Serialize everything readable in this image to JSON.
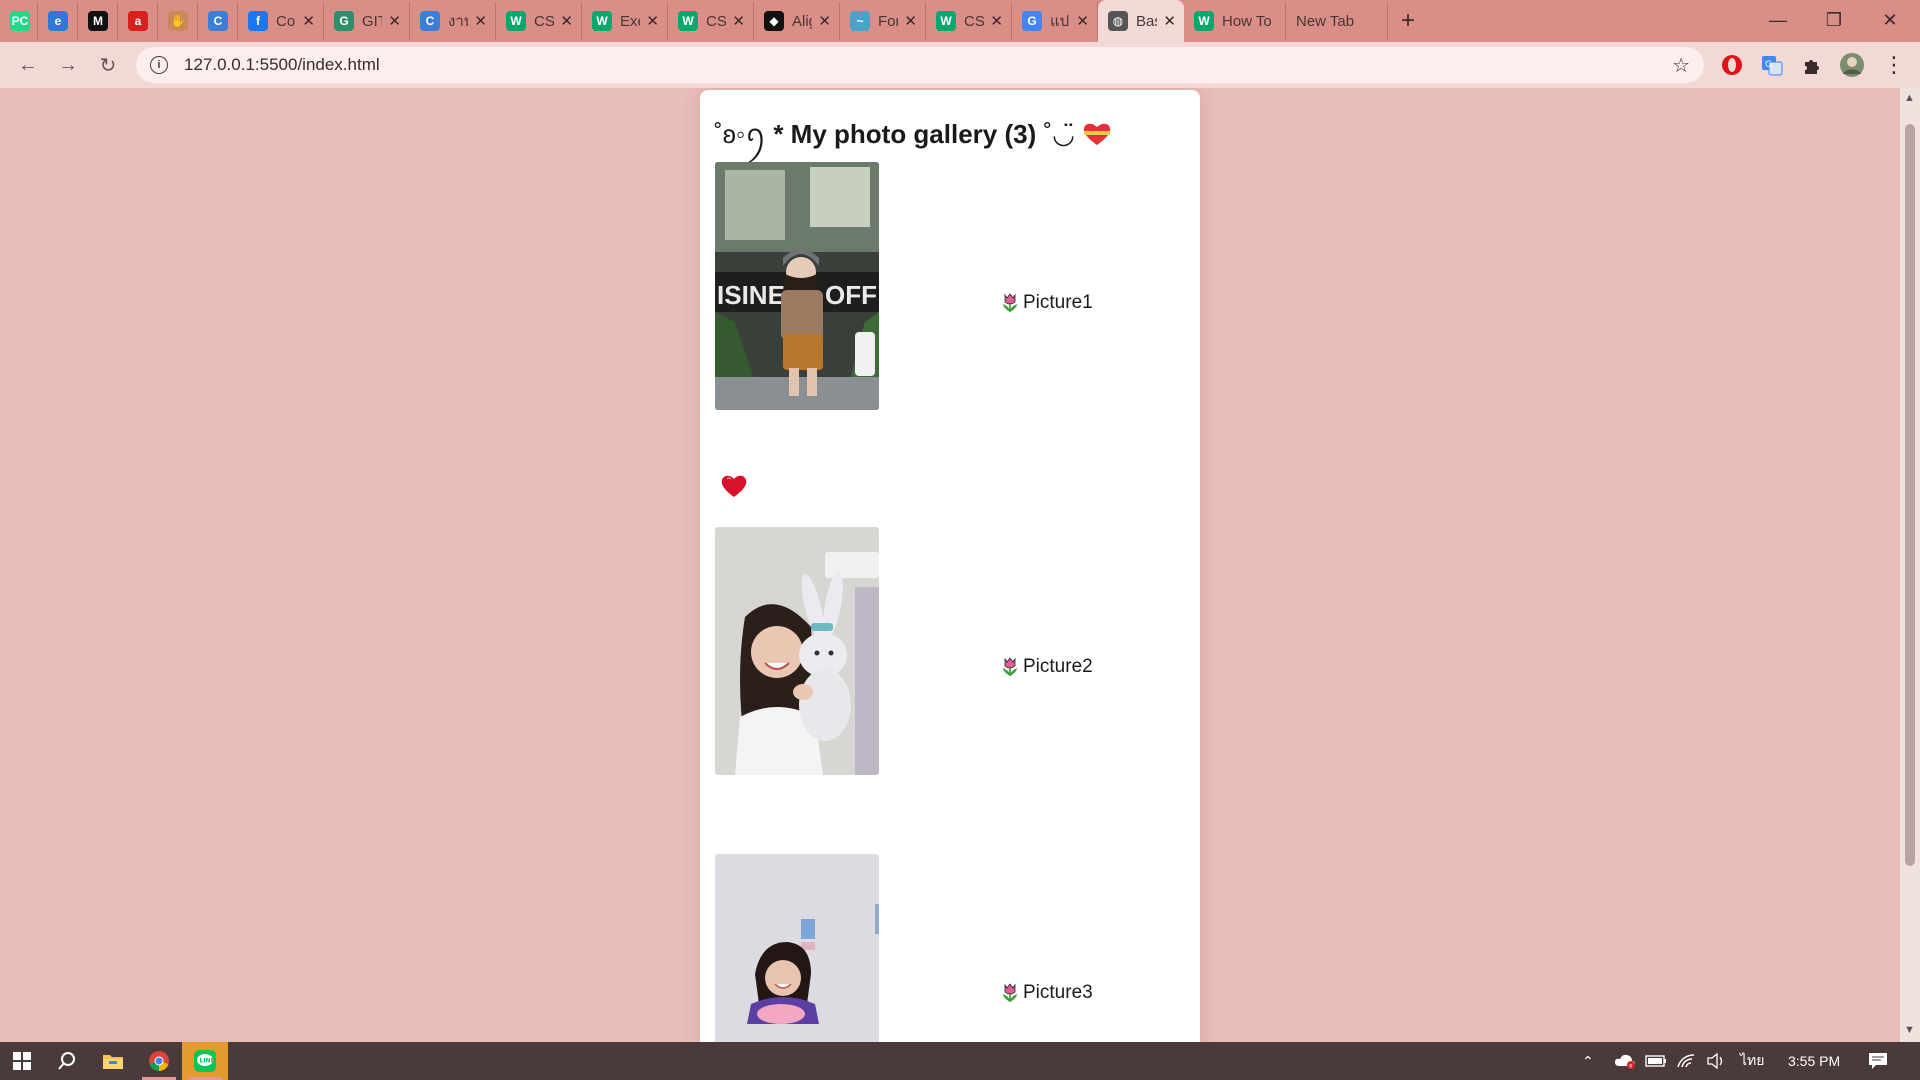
{
  "browser": {
    "tabs": [
      {
        "title": "",
        "favicon": "pycharm-icon",
        "color": "#21d789",
        "closable": false
      },
      {
        "title": "",
        "favicon": "edge-icon",
        "color": "#2a7ad6",
        "closable": false
      },
      {
        "title": "",
        "favicon": "medium-icon",
        "color": "#111111",
        "closable": false
      },
      {
        "title": "",
        "favicon": "acrobat-icon",
        "color": "#d8201d",
        "closable": false
      },
      {
        "title": "",
        "favicon": "hand-icon",
        "color": "#c98a5a",
        "closable": false
      },
      {
        "title": "",
        "favicon": "c-icon",
        "color": "#3b7ed8",
        "closable": false
      },
      {
        "title": "Cor",
        "favicon": "facebook-icon",
        "color": "#1877f2",
        "closable": true
      },
      {
        "title": "GIT",
        "favicon": "github-classroom-icon",
        "color": "#2d8f6f",
        "closable": true
      },
      {
        "title": "งาน",
        "favicon": "c-icon",
        "color": "#3b7ed8",
        "closable": true
      },
      {
        "title": "CSS",
        "favicon": "w3schools-icon",
        "color": "#04aa6d",
        "closable": true
      },
      {
        "title": "Exe",
        "favicon": "w3schools-icon",
        "color": "#04aa6d",
        "closable": true
      },
      {
        "title": "CSS",
        "favicon": "w3schools-icon",
        "color": "#04aa6d",
        "closable": true
      },
      {
        "title": "Alig",
        "favicon": "codepen-icon",
        "color": "#111111",
        "closable": true
      },
      {
        "title": "For",
        "favicon": "wave-icon",
        "color": "#4aa3c8",
        "closable": true
      },
      {
        "title": "CSS",
        "favicon": "w3schools-icon",
        "color": "#04aa6d",
        "closable": true
      },
      {
        "title": "แปล",
        "favicon": "google-icon",
        "color": "#4285f4",
        "closable": true
      },
      {
        "title": "Basi",
        "favicon": "globe-icon",
        "color": "#555555",
        "closable": true,
        "active": true
      },
      {
        "title": "How To",
        "favicon": "w3schools-icon",
        "color": "#04aa6d",
        "closable": false
      },
      {
        "title": "New Tab",
        "favicon": "",
        "color": "",
        "closable": false
      }
    ],
    "new_tab_label": "+",
    "url": "127.0.0.1:5500/index.html"
  },
  "page": {
    "heading_prefix": "˚ʚ◦ꪆ",
    "heading_text": "* My photo gallery (3)",
    "heading_suffix": "˚◡̈",
    "pictures": [
      {
        "label": "Picture1"
      },
      {
        "label": "Picture2"
      },
      {
        "label": "Picture3"
      }
    ]
  },
  "taskbar": {
    "language": "ไทย",
    "time": "3:55 PM"
  }
}
